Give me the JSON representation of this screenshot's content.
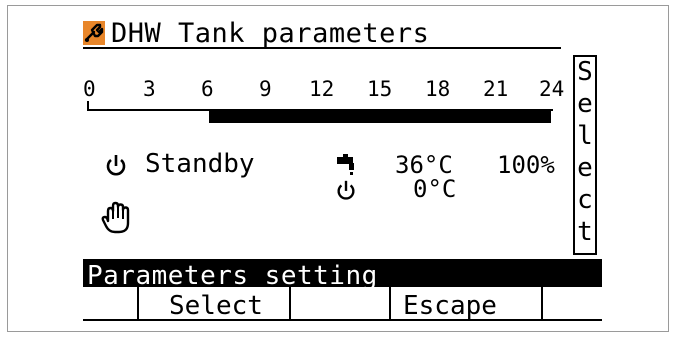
{
  "screen": {
    "title": "DHW Tank parameters",
    "title_icon": "wrench-icon",
    "accent_color": "#e8862a"
  },
  "scale": {
    "ticks": [
      "0",
      "3",
      "6",
      "9",
      "12",
      "15",
      "18",
      "21",
      "24"
    ],
    "active_from": 6,
    "active_to": 24
  },
  "side_panel": {
    "label": "Select",
    "letters": [
      "S",
      "e",
      "l",
      "e",
      "c",
      "t"
    ]
  },
  "status": {
    "power_icon": "power-icon",
    "mode": "Standby",
    "tap_icon": "tap-icon",
    "tap_temp": "36°C",
    "percent": "100%",
    "set_power_icon": "power-icon",
    "set_temp": "0°C",
    "hand_icon": "hand-icon"
  },
  "footer": {
    "info_bar": "Parameters setting",
    "softkeys": [
      "",
      "Select",
      "",
      "Escape",
      ""
    ]
  }
}
